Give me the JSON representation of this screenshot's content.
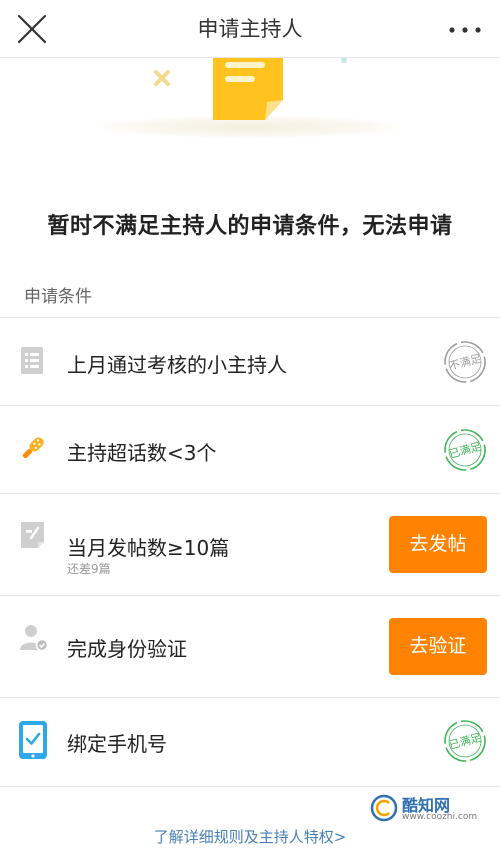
{
  "nav": {
    "title": "申请主持人",
    "close_icon": "close-icon",
    "more_icon": "more-icon"
  },
  "hero": {
    "illustration": "document-icon"
  },
  "notice": "暂时不满足主持人的申请条件，无法申请",
  "section_label": "申请条件",
  "conditions": [
    {
      "label": "上月通过考核的小主持人",
      "icon": "list-icon",
      "status": "不满足",
      "status_color": "#9e9e9e"
    },
    {
      "label": "主持超话数<3个",
      "icon": "microphone-icon",
      "status": "已满足",
      "status_color": "#43b45a"
    },
    {
      "label": "当月发帖数≥10篇",
      "sub": "还差9篇",
      "icon": "edit-icon",
      "action": "去发帖"
    },
    {
      "label": "完成身份验证",
      "icon": "user-verify-icon",
      "action": "去验证"
    },
    {
      "label": "绑定手机号",
      "icon": "phone-check-icon",
      "status": "已满足",
      "status_color": "#43b45a"
    }
  ],
  "footer_link": "了解详细规则及主持人特权>",
  "watermark": {
    "name": "酷知网",
    "url": "www.coozhi.com"
  },
  "colors": {
    "accent": "#ff8200",
    "link": "#4a7fb6",
    "ok": "#43b45a",
    "muted": "#9e9e9e"
  }
}
